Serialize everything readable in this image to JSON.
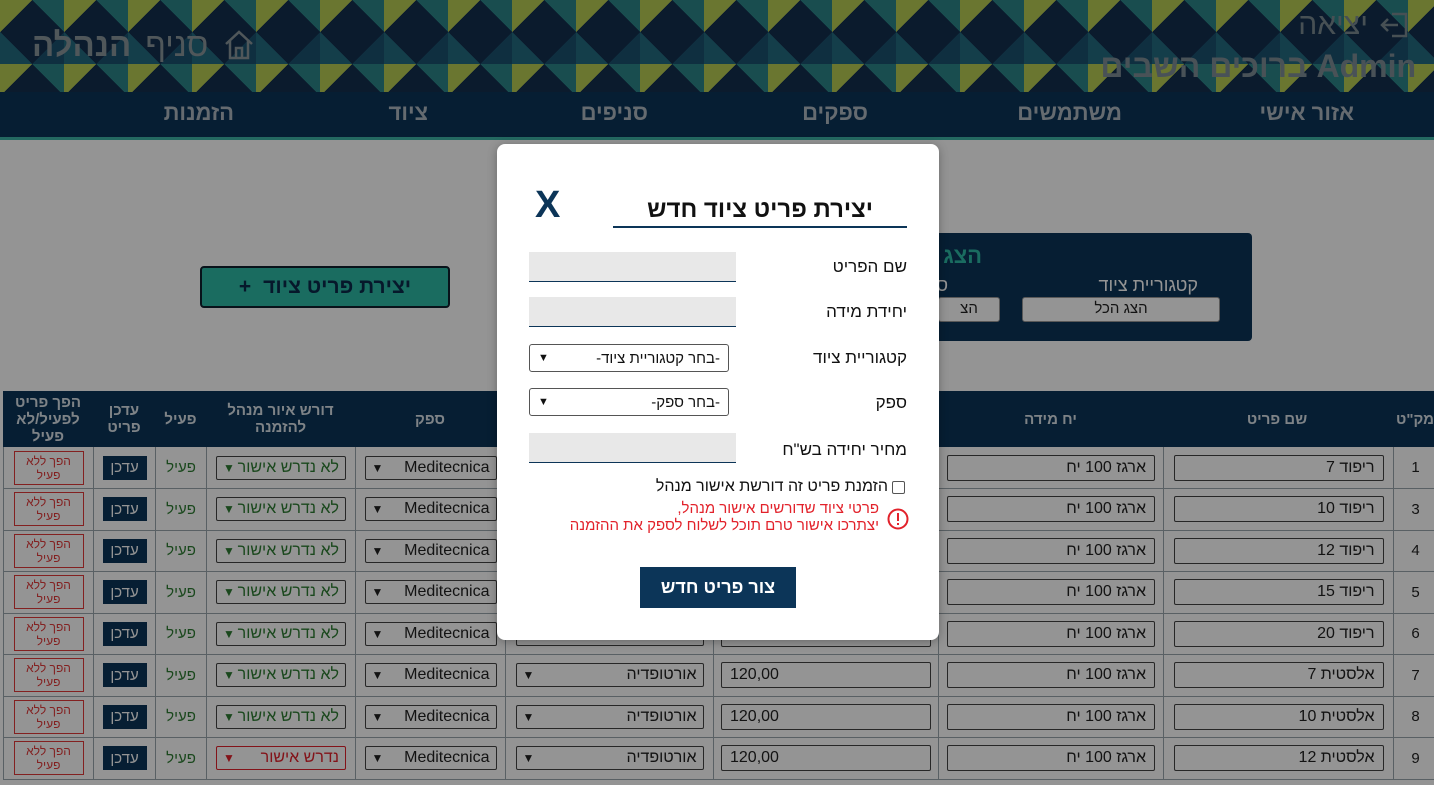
{
  "header": {
    "logout_label": "יציאה",
    "welcome": "Admin ברוכים השבים",
    "branch_label": "סניף",
    "branch_name": "הנהלה"
  },
  "nav": [
    "אזור אישי",
    "משתמשים",
    "ספקים",
    "סניפים",
    "ציוד",
    "הזמנות"
  ],
  "toolbar": {
    "create_label": "יצירת פריט ציוד",
    "create_icon": "plus-icon"
  },
  "filter": {
    "title": "הצג",
    "category_label": "קטגוריית ציוד",
    "category_value": "הצג הכל",
    "second_label": "ס",
    "second_value": "הצ"
  },
  "table": {
    "headers": {
      "sku": "מק\"ט",
      "name": "שם פריט",
      "unit": "יח מידה",
      "price": "",
      "category": "",
      "supplier": "ספק",
      "approval": "דורש איור מנהל להזמנה",
      "active": "פעיל",
      "edit": "עדכן פריט",
      "toggle": "הפך פריט לפעיל/לא פעיל"
    },
    "rows": [
      {
        "sku": "1",
        "name": "ריפוד 7",
        "unit": "ארגז 100 יח",
        "price": "",
        "category": "",
        "supplier": "Meditecnica",
        "approval": "לא נדרש אישור",
        "approval_state": "ok",
        "active": "פעיל",
        "edit": "עדכן",
        "toggle": "הפך ללא פעיל"
      },
      {
        "sku": "3",
        "name": "ריפוד 10",
        "unit": "ארגז 100 יח",
        "price": "",
        "category": "",
        "supplier": "Meditecnica",
        "approval": "לא נדרש אישור",
        "approval_state": "ok",
        "active": "פעיל",
        "edit": "עדכן",
        "toggle": "הפך ללא פעיל"
      },
      {
        "sku": "4",
        "name": "ריפוד 12",
        "unit": "ארגז 100 יח",
        "price": "",
        "category": "",
        "supplier": "Meditecnica",
        "approval": "לא נדרש אישור",
        "approval_state": "ok",
        "active": "פעיל",
        "edit": "עדכן",
        "toggle": "הפך ללא פעיל"
      },
      {
        "sku": "5",
        "name": "ריפוד 15",
        "unit": "ארגז 100 יח",
        "price": "",
        "category": "",
        "supplier": "Meditecnica",
        "approval": "לא נדרש אישור",
        "approval_state": "ok",
        "active": "פעיל",
        "edit": "עדכן",
        "toggle": "הפך ללא פעיל"
      },
      {
        "sku": "6",
        "name": "ריפוד 20",
        "unit": "ארגז 100 יח",
        "price": "",
        "category": "",
        "supplier": "Meditecnica",
        "approval": "לא נדרש אישור",
        "approval_state": "ok",
        "active": "פעיל",
        "edit": "עדכן",
        "toggle": "הפך ללא פעיל"
      },
      {
        "sku": "7",
        "name": "אלסטית 7",
        "unit": "ארגז 100 יח",
        "price": "120,00",
        "category": "אורטופדיה",
        "supplier": "Meditecnica",
        "approval": "לא נדרש אישור",
        "approval_state": "ok",
        "active": "פעיל",
        "edit": "עדכן",
        "toggle": "הפך ללא פעיל"
      },
      {
        "sku": "8",
        "name": "אלסטית 10",
        "unit": "ארגז 100 יח",
        "price": "120,00",
        "category": "אורטופדיה",
        "supplier": "Meditecnica",
        "approval": "לא נדרש אישור",
        "approval_state": "ok",
        "active": "פעיל",
        "edit": "עדכן",
        "toggle": "הפך ללא פעיל"
      },
      {
        "sku": "9",
        "name": "אלסטית 12",
        "unit": "ארגז 100 יח",
        "price": "120,00",
        "category": "אורטופדיה",
        "supplier": "Meditecnica",
        "approval": "נדרש אישור",
        "approval_state": "required",
        "active": "פעיל",
        "edit": "עדכן",
        "toggle": "הפך ללא פעיל"
      }
    ]
  },
  "modal": {
    "title": "יצירת פריט ציוד חדש",
    "close": "X",
    "fields": {
      "name_label": "שם הפריט",
      "unit_label": "יחידת מידה",
      "category_label": "קטגוריית ציוד",
      "category_value": "-בחר קטגוריית ציוד-",
      "supplier_label": "ספק",
      "supplier_value": "-בחר ספק-",
      "price_label": "מחיר יחידה בש\"ח"
    },
    "checkbox_label": "הזמנת פריט זה דורשת אישור מנהל",
    "warning_line1": "פרטי ציוד שדורשים אישור מנהל,",
    "warning_line2": "יצתרכו אישור טרם תוכל לשלוח לספק את ההזמנה",
    "submit": "צור פריט חדש"
  },
  "colors": {
    "navy": "#0c3558",
    "teal": "#2dbba6",
    "warning_red": "#e2222b",
    "approval_ok": "#2e7d32"
  }
}
